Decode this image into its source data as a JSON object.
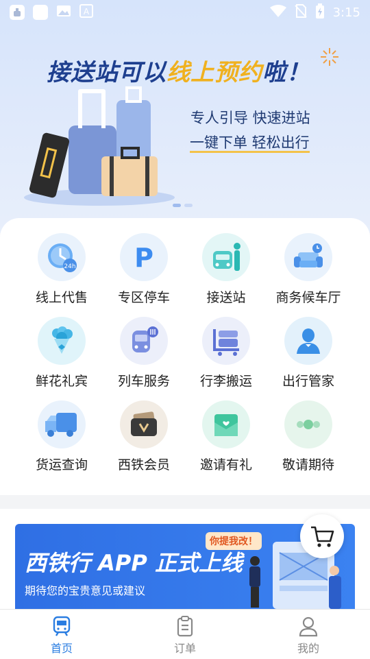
{
  "status_bar": {
    "time": "3:15",
    "icons": [
      "app-icon",
      "blank-icon",
      "image-icon",
      "text-icon",
      "wifi-icon",
      "no-sim-icon",
      "battery-icon"
    ]
  },
  "banner": {
    "headline_part1": "接送站可以",
    "headline_part2": "线上预约",
    "headline_part3": "啦！",
    "line1": "专人引导 快速进站",
    "line2": "一键下单 轻松出行",
    "colors": {
      "headline": "#1e3f8f",
      "highlight": "#f0b11f",
      "background": "#d6e4fb"
    }
  },
  "services": [
    {
      "label": "线上代售",
      "icon": "clock-24h-icon"
    },
    {
      "label": "专区停车",
      "icon": "parking-icon"
    },
    {
      "label": "接送站",
      "icon": "train-person-icon"
    },
    {
      "label": "商务候车厅",
      "icon": "sofa-icon"
    },
    {
      "label": "鲜花礼宾",
      "icon": "flower-bouquet-icon"
    },
    {
      "label": "列车服务",
      "icon": "train-food-icon"
    },
    {
      "label": "行李搬运",
      "icon": "luggage-cart-icon"
    },
    {
      "label": "出行管家",
      "icon": "butler-icon"
    },
    {
      "label": "货运查询",
      "icon": "truck-icon"
    },
    {
      "label": "西铁会员",
      "icon": "member-wallet-icon"
    },
    {
      "label": "邀请有礼",
      "icon": "invite-envelope-icon"
    },
    {
      "label": "敬请期待",
      "icon": "more-dots-icon"
    }
  ],
  "ad": {
    "tag": "你提我改！",
    "title": "西铁行 APP 正式上线",
    "subtitle": "期待您的宝贵意见或建议"
  },
  "cart": {
    "icon": "cart-icon"
  },
  "tabs": [
    {
      "label": "首页",
      "icon": "train-tab-icon",
      "active": true
    },
    {
      "label": "订单",
      "icon": "clipboard-icon",
      "active": false
    },
    {
      "label": "我的",
      "icon": "user-icon",
      "active": false
    }
  ],
  "accent": "#2a7de1"
}
